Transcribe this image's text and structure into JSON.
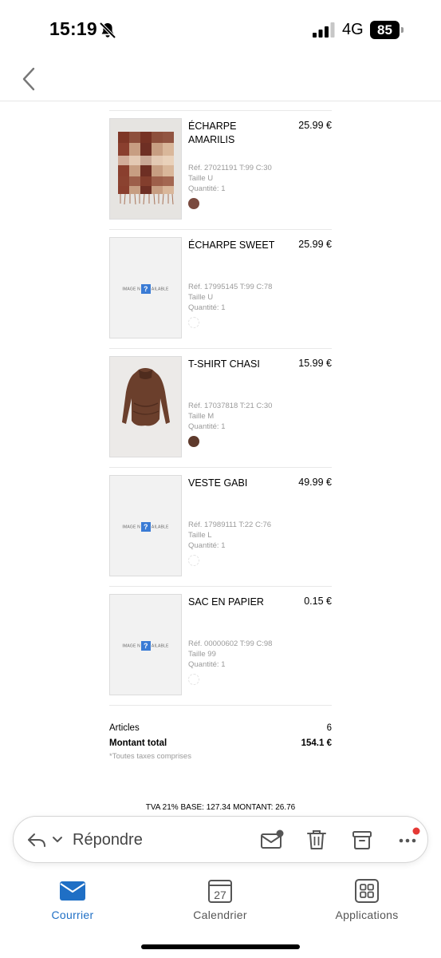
{
  "status_bar": {
    "time": "15:19",
    "network": "4G",
    "battery": "85"
  },
  "items": [
    {
      "name": "ÉCHARPE AMARILIS",
      "price": "25.99 €",
      "ref": "Réf. 27021191 T:99 C:30",
      "size": "Taille U",
      "qty": "Quantité: 1",
      "image": "scarf",
      "swatch": "#7a4a3f"
    },
    {
      "name": "ÉCHARPE SWEET",
      "price": "25.99 €",
      "ref": "Réf. 17995145 T:99 C:78",
      "size": "Taille U",
      "qty": "Quantité: 1",
      "image": "placeholder",
      "swatch": ""
    },
    {
      "name": "T-SHIRT CHASI",
      "price": "15.99 €",
      "ref": "Réf. 17037818 T:21 C:30",
      "size": "Taille M",
      "qty": "Quantité: 1",
      "image": "tshirt",
      "swatch": "#5e3a2c"
    },
    {
      "name": "VESTE GABI",
      "price": "49.99 €",
      "ref": "Réf. 17989111 T:22 C:76",
      "size": "Taille L",
      "qty": "Quantité: 1",
      "image": "placeholder",
      "swatch": ""
    },
    {
      "name": "SAC EN PAPIER",
      "price": "0.15 €",
      "ref": "Réf. 00000602 T:99 C:98",
      "size": "Taille 99",
      "qty": "Quantité: 1",
      "image": "placeholder",
      "swatch": ""
    }
  ],
  "image_placeholder": {
    "left": "IMAGE N",
    "mark": "?",
    "right": "AILABLE"
  },
  "totals": {
    "articles_label": "Articles",
    "articles_value": "6",
    "total_label": "Montant total",
    "total_value": "154.1 €",
    "note": "*Toutes taxes comprises"
  },
  "tva_line": "TVA 21% BASE: 127.34 MONTANT: 26.76",
  "reply_bar": {
    "reply_label": "Répondre"
  },
  "tabs": [
    {
      "label": "Courrier"
    },
    {
      "label": "Calendrier",
      "date": "27"
    },
    {
      "label": "Applications"
    }
  ],
  "colors": {
    "accent": "#1f6fc5",
    "badge": "#e53935"
  }
}
